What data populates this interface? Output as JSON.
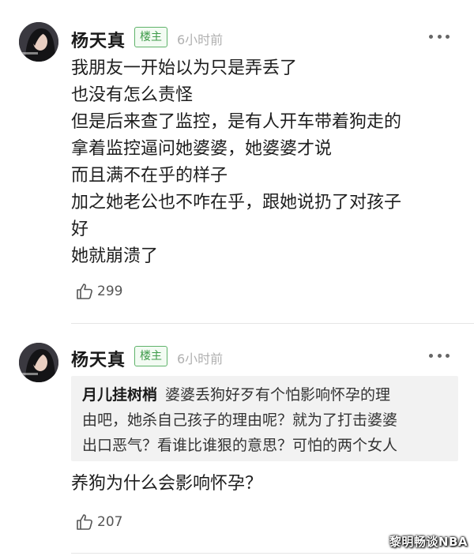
{
  "comments": [
    {
      "username": "杨天真",
      "badge": "楼主",
      "time": "6小时前",
      "lines": [
        "我朋友一开始以为只是弄丢了",
        "也没有怎么责怪",
        "但是后来查了监控，是有人开车带着狗走的",
        "拿着监控逼问她婆婆，她婆婆才说",
        "而且满不在乎的样子",
        "加之她老公也不咋在乎，跟她说扔了对孩子",
        "好",
        "她就崩溃了"
      ],
      "likes": "299"
    },
    {
      "username": "杨天真",
      "badge": "楼主",
      "time": "6小时前",
      "quote": {
        "author": "月儿挂树梢",
        "lines": [
          "婆婆丢狗好歹有个怕影响怀孕的理",
          "由吧，她杀自己孩子的理由呢？就为了打击婆婆",
          "出口恶气？看谁比谁狠的意思？可怕的两个女人"
        ]
      },
      "reply": "养狗为什么会影响怀孕？",
      "likes": "207"
    }
  ],
  "icons": {
    "more": "more-dots-icon",
    "like": "thumbs-up-icon"
  },
  "colors": {
    "badge_green": "#3e9b4a",
    "quote_bg": "#f2f2f2",
    "time_gray": "#b0b0b0"
  },
  "watermark": "黎明畅谈NBA"
}
